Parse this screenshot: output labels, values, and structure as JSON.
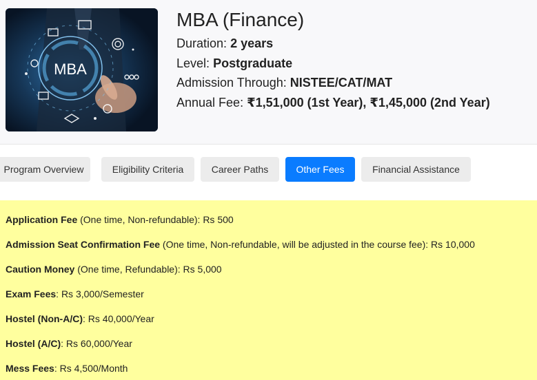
{
  "program": {
    "title": "MBA (Finance)",
    "image_text": "MBA",
    "details": [
      {
        "label": "Duration:",
        "value": "2 years"
      },
      {
        "label": "Level:",
        "value": "Postgraduate"
      },
      {
        "label": "Admission Through:",
        "value": "NISTEE/CAT/MAT"
      },
      {
        "label": "Annual Fee:",
        "value": "₹1,51,000 (1st Year), ₹1,45,000 (2nd Year)"
      }
    ]
  },
  "tabs": [
    {
      "label": "Program Overview",
      "active": false
    },
    {
      "label": "Eligibility Criteria",
      "active": false
    },
    {
      "label": "Career Paths",
      "active": false
    },
    {
      "label": "Other Fees",
      "active": true
    },
    {
      "label": "Financial Assistance",
      "active": false
    }
  ],
  "fees": [
    {
      "name": "Application Fee",
      "detail": " (One time, Non-refundable): Rs 500"
    },
    {
      "name": "Admission Seat Confirmation Fee",
      "detail": " (One time, Non-refundable, will be adjusted in the course fee): Rs 10,000"
    },
    {
      "name": "Caution Money",
      "detail": " (One time, Refundable): Rs 5,000"
    },
    {
      "name": "Exam Fees",
      "detail": ": Rs 3,000/Semester"
    },
    {
      "name": "Hostel (Non-A/C)",
      "detail": ": Rs 40,000/Year"
    },
    {
      "name": "Hostel (A/C)",
      "detail": ": Rs 60,000/Year"
    },
    {
      "name": "Mess Fees",
      "detail": ": Rs 4,500/Month"
    }
  ],
  "colors": {
    "active_tab": "#0a7cff",
    "inactive_tab": "#ececec",
    "fees_background": "#ffff9e",
    "header_background": "#f8f8fa"
  }
}
